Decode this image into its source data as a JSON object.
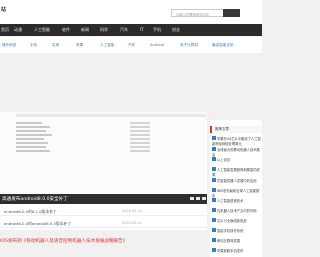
{
  "header": {
    "logo": "站",
    "search_placeholder": "请输入您要搜索的内容"
  },
  "nav": [
    "首页",
    "动漫",
    "人工智能",
    "软件",
    "新闻",
    "科学",
    "汽车",
    "IT",
    "手机",
    "创业"
  ],
  "tags": [
    "操作系统",
    "手机",
    "实用",
    "苹果",
    "人工智能",
    "汽车",
    "Android",
    "电子计算机",
    "最佳智能手机"
  ],
  "main": {
    "title": "高通发布android8.0.0安全补丁",
    "list": [
      {
        "title": "android8.0.0的8.1.0版本补丁",
        "date": "2018-05-14"
      },
      {
        "title": "android8.0.0的android8.0.0版本补丁",
        "date": "2018-05-14"
      }
    ],
    "bottom_title": "IOS发布到《移动机器人及语音控制机器人技术发展战略报告》"
  },
  "sidebar": {
    "heading": "推荐文章",
    "items": [
      "苹果在A9芯片中集成了人工智能神经网络处理单元",
      "全球最大的移动机器人技术展会",
      "以上说法",
      "人工智能发展趋势和展望的成果",
      "在智能机器人发展中的应用",
      "IBM发布最新全球人工智能报告",
      "人工智能语音技术",
      "在机器人技术产业中的作用",
      "芯片行业面临新挑战",
      "智能手机操作系统",
      "移动互联网发展",
      "苹果新款手机发布"
    ]
  }
}
